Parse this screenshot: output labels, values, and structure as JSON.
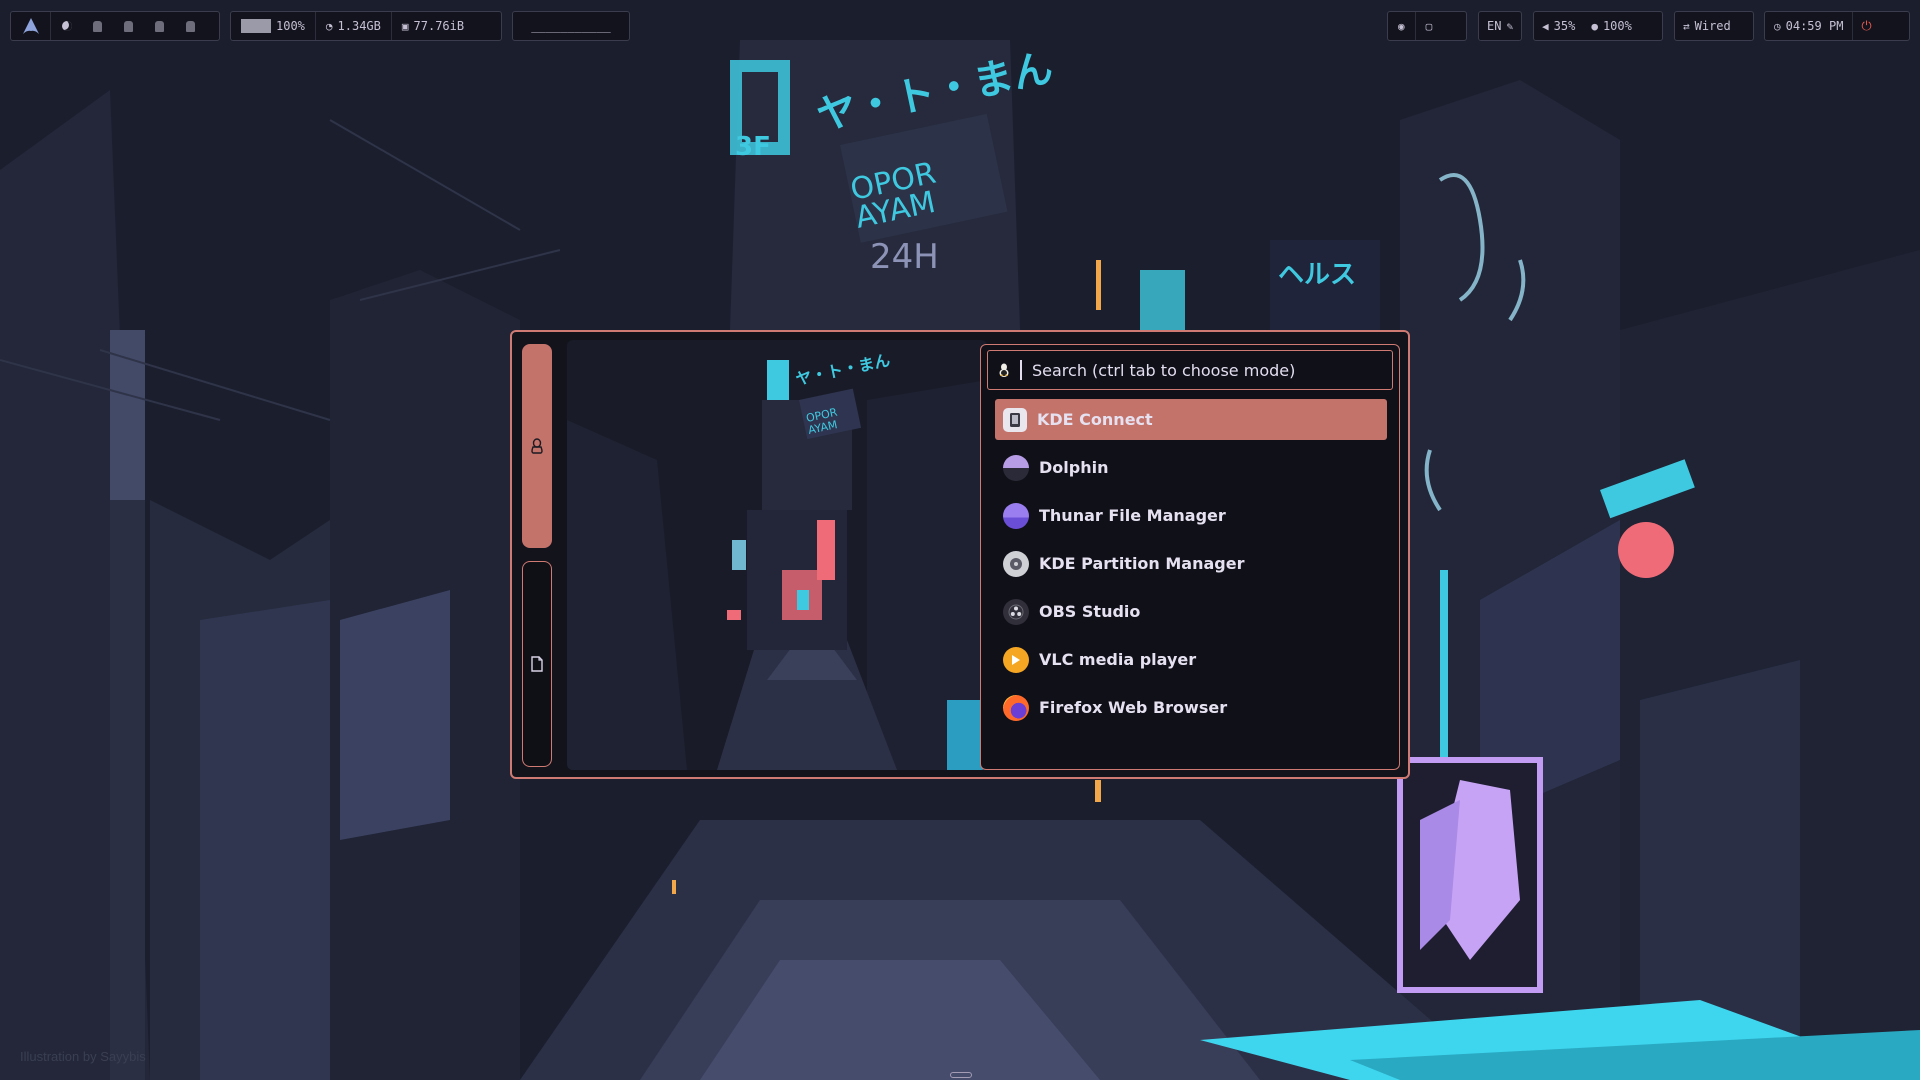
{
  "wallpaper": {
    "credit_text": "Illustration by Sayybis",
    "sign_opor": "OPOR",
    "sign_ayam": "AYAM",
    "sign_24h": "24H",
    "sign_katakana": "ヘルス"
  },
  "topbar": {
    "workspaces": [
      "arch-logo-icon",
      "moon-icon",
      "ws-icon",
      "ws-icon",
      "ws-icon",
      "ws-icon"
    ],
    "battery_percent": "100%",
    "memory": "1.34GB",
    "disk": "77.76iB",
    "window_title": "___________",
    "keyboard_layout": "EN",
    "volume": "35%",
    "mic": "100%",
    "network": "Wired",
    "clock": "04:59 PM"
  },
  "launcher": {
    "modes": [
      {
        "name": "tux-icon",
        "active": true
      },
      {
        "name": "file-icon",
        "active": false
      }
    ],
    "search_placeholder": "Search (ctrl tab to choose mode)",
    "results": [
      {
        "label": "KDE Connect",
        "icon": "kdeconnect-icon",
        "selected": true
      },
      {
        "label": "Dolphin",
        "icon": "dolphin-icon"
      },
      {
        "label": "Thunar File Manager",
        "icon": "thunar-icon"
      },
      {
        "label": "KDE Partition Manager",
        "icon": "partition-manager-icon"
      },
      {
        "label": "OBS Studio",
        "icon": "obs-icon"
      },
      {
        "label": "VLC media player",
        "icon": "vlc-icon"
      },
      {
        "label": "Firefox Web Browser",
        "icon": "firefox-icon"
      }
    ]
  },
  "colors": {
    "accent": "#c4736b",
    "border": "#cf7a72",
    "cyan": "#3fc9e0",
    "panel_bg": "#13131c",
    "wallpaper_bg": "#1b1e2d"
  }
}
